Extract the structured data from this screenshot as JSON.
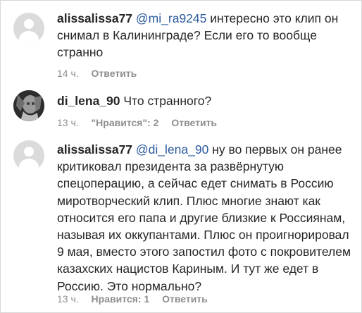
{
  "comments": [
    {
      "username": "alissalissa77",
      "mention": "@mi_ra9245",
      "text": "интересно это клип он снимал в Калининграде? Если его то вообще странно",
      "time": "14 ч.",
      "likes_label": "",
      "reply_label": "Ответить"
    },
    {
      "username": "di_lena_90",
      "mention": "",
      "text": "Что странного?",
      "time": "13 ч.",
      "likes_label": "\"Нравится\": 2",
      "reply_label": "Ответить"
    },
    {
      "username": "alissalissa77",
      "mention": "@di_lena_90",
      "text": "ну во первых он ранее критиковал президента за развёрнутую спецоперацию, а сейчас едет снимать в Россию миротворческий клип. Плюс многие знают как относится его папа и другие близкие к Россиянам, называя их оккупантами. Плюс он проигнорировал 9 мая, вместо этого запостил фото с покровителем казахских нацистов Кариным. И тут же едет в Россию. Это нормально?",
      "time": "13 ч.",
      "likes_label": "Нравится: 1",
      "reply_label": "Ответить"
    }
  ]
}
